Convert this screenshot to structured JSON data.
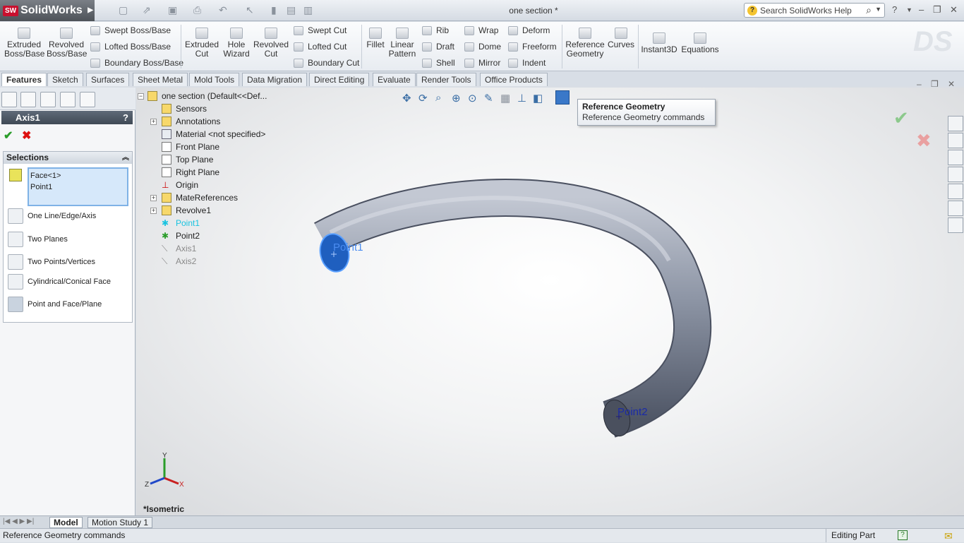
{
  "app": {
    "logo": "SolidWorks",
    "logo_badge": "SW",
    "document_title": "one section *"
  },
  "search": {
    "text": "Search SolidWorks Help"
  },
  "ribbon": {
    "extruded_boss": "Extruded Boss/Base",
    "revolved_boss": "Revolved Boss/Base",
    "swept_boss": "Swept Boss/Base",
    "lofted_boss": "Lofted Boss/Base",
    "boundary_boss": "Boundary Boss/Base",
    "extruded_cut": "Extruded Cut",
    "hole_wizard": "Hole Wizard",
    "revolved_cut": "Revolved Cut",
    "swept_cut": "Swept Cut",
    "lofted_cut": "Lofted Cut",
    "boundary_cut": "Boundary Cut",
    "fillet": "Fillet",
    "linear_pattern": "Linear Pattern",
    "rib": "Rib",
    "draft": "Draft",
    "shell": "Shell",
    "wrap": "Wrap",
    "dome": "Dome",
    "mirror": "Mirror",
    "deform": "Deform",
    "freeform": "Freeform",
    "indent": "Indent",
    "reference_geometry": "Reference Geometry",
    "curves": "Curves",
    "instant3d": "Instant3D",
    "equations": "Equations"
  },
  "tabs": [
    "Features",
    "Sketch",
    "Surfaces",
    "Sheet Metal",
    "Mold Tools",
    "Data Migration",
    "Direct Editing",
    "Evaluate",
    "Render Tools",
    "Office Products"
  ],
  "property_manager": {
    "title": "Axis1",
    "help": "?",
    "selections_header": "Selections",
    "selected": [
      "Face<1>",
      "Point1"
    ],
    "options": [
      "One Line/Edge/Axis",
      "Two Planes",
      "Two Points/Vertices",
      "Cylindrical/Conical Face",
      "Point and Face/Plane"
    ]
  },
  "tree": {
    "root": "one section  (Default<<Def...",
    "items": [
      "Sensors",
      "Annotations",
      "Material <not specified>",
      "Front Plane",
      "Top Plane",
      "Right Plane",
      "Origin",
      "MateReferences",
      "Revolve1",
      "Point1",
      "Point2",
      "Axis1",
      "Axis2"
    ]
  },
  "tooltip": {
    "title": "Reference Geometry",
    "body": "Reference Geometry commands"
  },
  "viewport": {
    "label_point1": "Point1",
    "label_point2": "Point2",
    "view_name": "*Isometric",
    "axis_x": "X",
    "axis_y": "Y",
    "axis_z": "Z"
  },
  "bottom_tabs": [
    "Model",
    "Motion Study 1"
  ],
  "status": {
    "message": "Reference Geometry commands",
    "mode": "Editing Part"
  },
  "colors": {
    "pipe": "#8a92a3",
    "selected_face": "#1f5fbf",
    "accent": "#3a6ea5"
  }
}
